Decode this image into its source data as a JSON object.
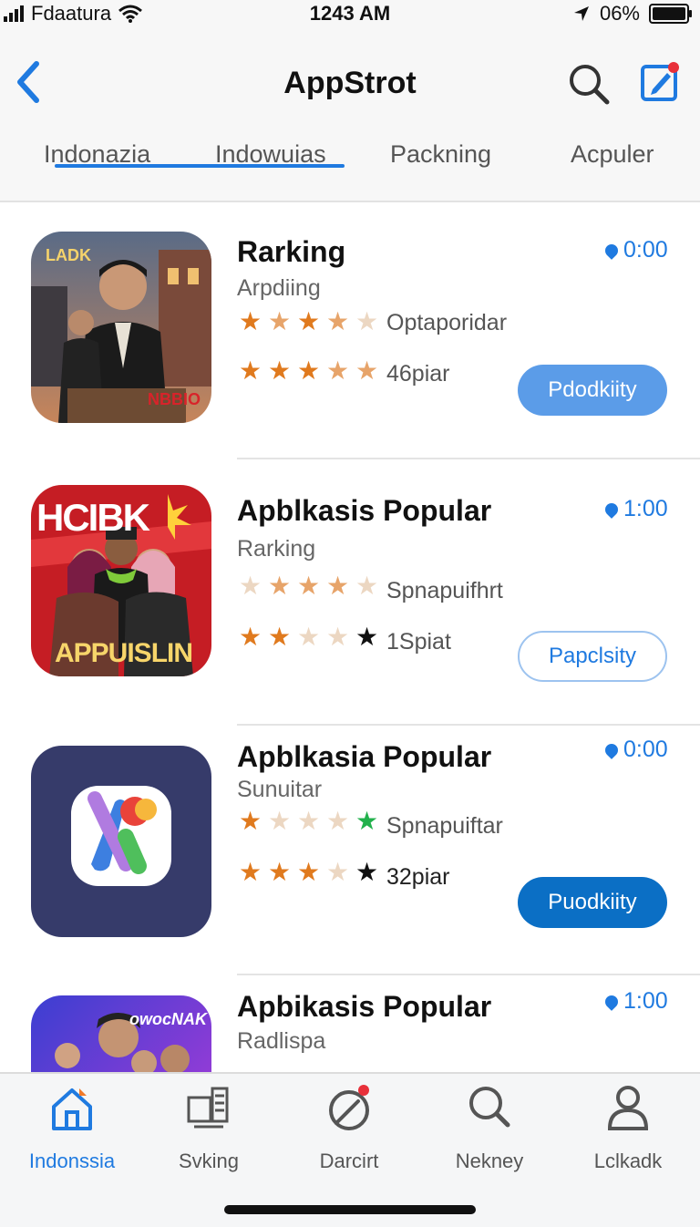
{
  "status_bar": {
    "carrier": "Fdaatura",
    "time": "1243 AM",
    "battery": "06%"
  },
  "header": {
    "title": "AppStrot"
  },
  "tabs": [
    {
      "label": "Indonazia"
    },
    {
      "label": "Indowuias"
    },
    {
      "label": "Packning"
    },
    {
      "label": "Acpuler"
    }
  ],
  "apps": [
    {
      "icon_text": "LADK",
      "icon_caption": "NBBIO",
      "title": "Rarking",
      "subtitle": "Arpdiing",
      "rating_text_1": "Optaporidar",
      "rating_text_2": "46piar",
      "price": "0:00",
      "button": "Pdodkiity"
    },
    {
      "icon_text": "HCIBK",
      "icon_caption": "APPUISLIN",
      "title": "Apblkasis Popular",
      "subtitle": "Rarking",
      "rating_text_1": "Spnapuifhrt",
      "rating_text_2": "1Spiat",
      "price": "1:00",
      "button": "Papclsity"
    },
    {
      "title": "Apblkasia Popular",
      "subtitle": "Sunuitar",
      "rating_text_1": "Spnapuiftar",
      "rating_text_2": "32piar",
      "price": "0:00",
      "button": "Puodkiity"
    },
    {
      "icon_text": "owocNAK",
      "title": "Apbikasis Popular",
      "subtitle": "Radlispa",
      "price": "1:00"
    }
  ],
  "tab_bar": [
    {
      "label": "Indonssia",
      "icon": "home-icon"
    },
    {
      "label": "Svking",
      "icon": "apps-icon"
    },
    {
      "label": "Darcirt",
      "icon": "compass-icon"
    },
    {
      "label": "Nekney",
      "icon": "search-icon"
    },
    {
      "label": "Lclkadk",
      "icon": "profile-icon"
    }
  ],
  "colors": {
    "accent": "#1f7ae0",
    "star": "#e07a1e",
    "button_filled": "#5b9ce8",
    "button_dark": "#0b6fc5"
  }
}
